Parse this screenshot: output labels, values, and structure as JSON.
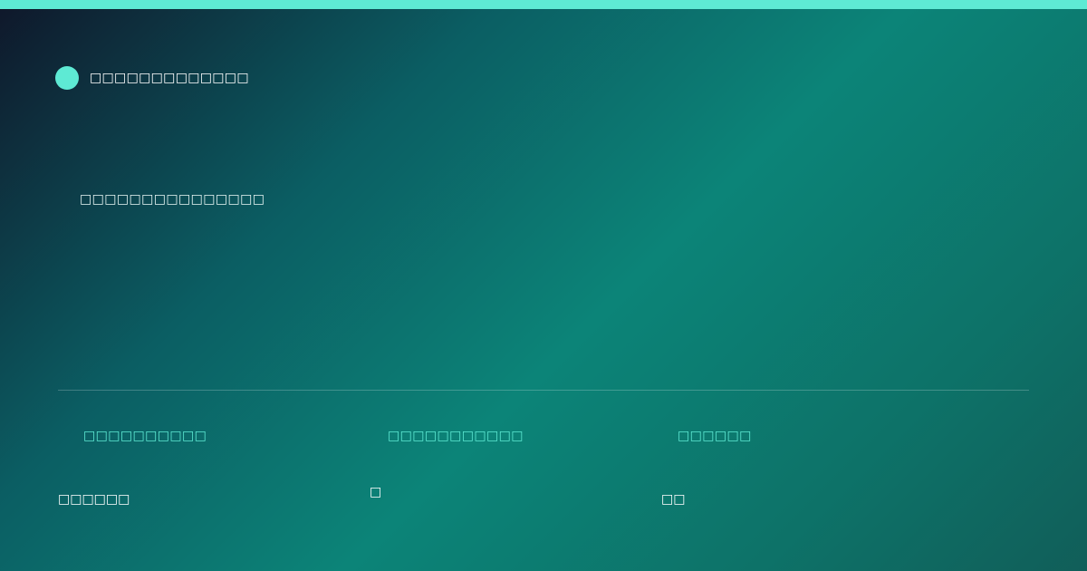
{
  "colors": {
    "accent": "#5eead4",
    "background_start": "#0f172a",
    "background_mid": "#0c8478",
    "background_end": "#115e59",
    "text": "#ffffff"
  },
  "header": {
    "brand_name": "□□□□□□□□□□□□□"
  },
  "hero": {
    "headline": "□□□□□□□□□□□□□□□"
  },
  "stats": [
    {
      "label": "□□□□□□□□□□",
      "value": "□□□□□□"
    },
    {
      "label": "□□□□□□□□□□□",
      "value": "□"
    },
    {
      "label": "□□□□□□",
      "value": "□□"
    }
  ]
}
